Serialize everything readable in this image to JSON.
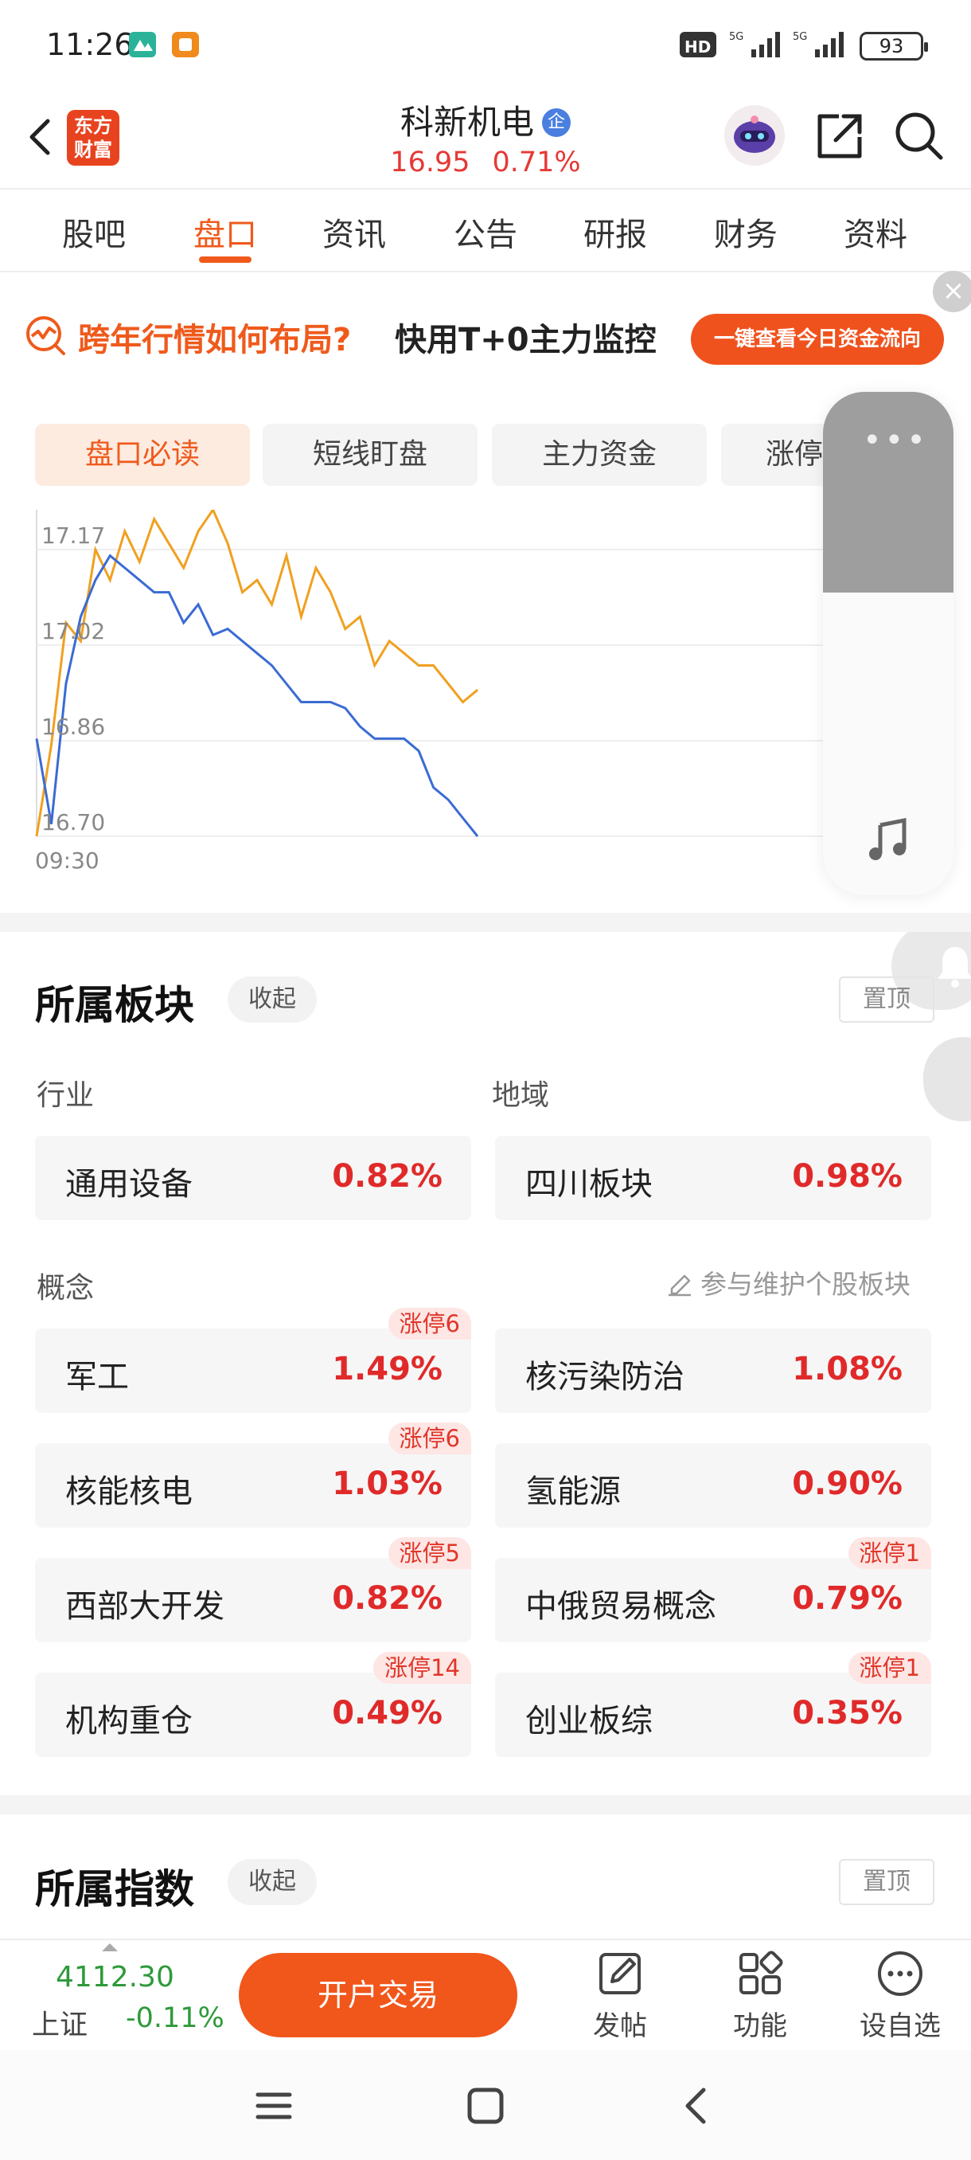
{
  "status_bar": {
    "time": "11:26",
    "battery": "93"
  },
  "header": {
    "logo_text": "东方\n财富",
    "stock_name": "科新机电",
    "corp_badge": "企",
    "price": "16.95",
    "change_pct": "0.71%"
  },
  "tabs": [
    "股吧",
    "盘口",
    "资讯",
    "公告",
    "研报",
    "财务",
    "资料"
  ],
  "banner": {
    "text_orange": "跨年行情如何布局?",
    "text_dark": "快用T+0主力监控",
    "cta": "一键查看今日资金流向",
    "close": "×"
  },
  "sub_tabs": [
    "盘口必读",
    "短线盯盘",
    "主力资金",
    "涨停"
  ],
  "chart_data": {
    "type": "line",
    "y_tick_labels": [
      "17.17",
      "17.02",
      "16.86",
      "16.70"
    ],
    "x_tick_labels": [
      "09:30"
    ],
    "ylim": [
      16.7,
      17.17
    ],
    "series": [
      {
        "color": "#f0a020",
        "values": [
          16.7,
          16.85,
          17.05,
          17.02,
          17.17,
          17.12,
          17.2,
          17.15,
          17.22,
          17.18,
          17.14,
          17.2,
          17.24,
          17.18,
          17.1,
          17.12,
          17.08,
          17.16,
          17.06,
          17.14,
          17.1,
          17.04,
          17.06,
          16.98,
          17.02,
          17.0,
          16.98,
          16.98,
          16.95,
          16.92,
          16.94
        ]
      },
      {
        "color": "#3a6bd4",
        "values": [
          16.86,
          16.72,
          16.95,
          17.06,
          17.12,
          17.16,
          17.14,
          17.12,
          17.1,
          17.1,
          17.05,
          17.08,
          17.03,
          17.04,
          17.02,
          17.0,
          16.98,
          16.95,
          16.92,
          16.92,
          16.92,
          16.91,
          16.88,
          16.86,
          16.86,
          16.86,
          16.84,
          16.78,
          16.76,
          16.73,
          16.7
        ]
      }
    ]
  },
  "sector": {
    "title": "所属板块",
    "collapse": "收起",
    "pin": "置顶",
    "industry_label": "行业",
    "region_label": "地域",
    "industry": {
      "name": "通用设备",
      "pct": "0.82%"
    },
    "region": {
      "name": "四川板块",
      "pct": "0.98%"
    },
    "concept_label": "概念",
    "maintain": "参与维护个股板块",
    "concepts": [
      {
        "name": "军工",
        "pct": "1.49%",
        "tag": "涨停6"
      },
      {
        "name": "核污染防治",
        "pct": "1.08%",
        "tag": ""
      },
      {
        "name": "核能核电",
        "pct": "1.03%",
        "tag": "涨停6"
      },
      {
        "name": "氢能源",
        "pct": "0.90%",
        "tag": ""
      },
      {
        "name": "西部大开发",
        "pct": "0.82%",
        "tag": "涨停5"
      },
      {
        "name": "中俄贸易概念",
        "pct": "0.79%",
        "tag": "涨停1"
      },
      {
        "name": "机构重仓",
        "pct": "0.49%",
        "tag": "涨停14"
      },
      {
        "name": "创业板综",
        "pct": "0.35%",
        "tag": "涨停1"
      }
    ]
  },
  "index_section": {
    "title": "所属指数",
    "collapse": "收起",
    "pin": "置顶"
  },
  "bottom_bar": {
    "index_value": "4112.30",
    "index_name": "上证",
    "index_change": "-0.11%",
    "trade": "开户交易",
    "post": "发帖",
    "function": "功能",
    "watchlist": "设自选"
  }
}
